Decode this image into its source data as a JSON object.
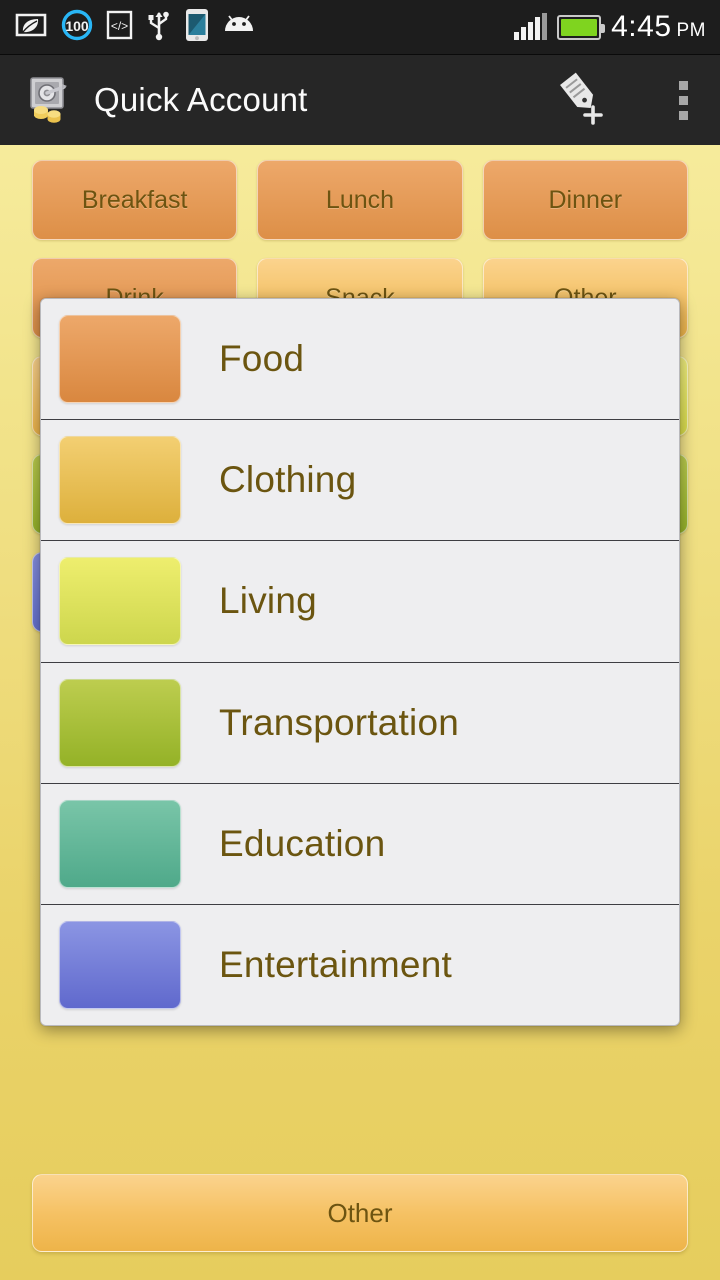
{
  "statusbar": {
    "icons": [
      "battery-saver-leaf-icon",
      "battery-100-circle-icon",
      "developer-mode-icon",
      "usb-icon",
      "phone-icon",
      "android-head-icon"
    ],
    "battery_level_label": "100",
    "signal_icon": "signal-bars-icon",
    "battery_icon": "battery-full-icon",
    "time": "4:45",
    "ampm": "PM"
  },
  "actionbar": {
    "app_icon": "safe-vault-coins-icon",
    "title": "Quick Account",
    "add_entry_icon": "add-note-pencil-icon",
    "overflow_icon": "overflow-menu-icon"
  },
  "grid": {
    "buttons": [
      {
        "label": "Breakfast",
        "color_top": "#eda86a",
        "color_bottom": "#dd8f47"
      },
      {
        "label": "Lunch",
        "color_top": "#eda86a",
        "color_bottom": "#dd8f47"
      },
      {
        "label": "Dinner",
        "color_top": "#eda86a",
        "color_bottom": "#dd8f47"
      },
      {
        "label": "Drink",
        "color_top": "#eda86a",
        "color_bottom": "#dd8f47"
      },
      {
        "label": "Snack",
        "color_top": "#fbd38d",
        "color_bottom": "#eeb449"
      },
      {
        "label": "Other",
        "color_top": "#fbd38d",
        "color_bottom": "#eeb449"
      },
      {
        "label": "",
        "color_top": "#fbd38d",
        "color_bottom": "#eeb449"
      },
      {
        "label": "",
        "color_top": "#f0ee7e",
        "color_bottom": "#d9dc4a"
      },
      {
        "label": "",
        "color_top": "#f0ee7e",
        "color_bottom": "#d9dc4a"
      },
      {
        "label": "",
        "color_top": "#bbcc4e",
        "color_bottom": "#96b32a"
      },
      {
        "label": "",
        "color_top": "#bbcc4e",
        "color_bottom": "#96b32a"
      },
      {
        "label": "",
        "color_top": "#bbcc4e",
        "color_bottom": "#96b32a"
      },
      {
        "label": "",
        "color_top": "#8690e0",
        "color_bottom": "#6571d0"
      }
    ]
  },
  "dialog": {
    "items": [
      {
        "label": "Food",
        "color_top": "#eda86a",
        "color_bottom": "#d9873f"
      },
      {
        "label": "Clothing",
        "color_top": "#f3cf72",
        "color_bottom": "#ddb03c"
      },
      {
        "label": "Living",
        "color_top": "#eeee6e",
        "color_bottom": "#cdd64d"
      },
      {
        "label": "Transportation",
        "color_top": "#bdcd4f",
        "color_bottom": "#94b227"
      },
      {
        "label": "Education",
        "color_top": "#79c5a8",
        "color_bottom": "#4fa98a"
      },
      {
        "label": "Entertainment",
        "color_top": "#8b95e3",
        "color_bottom": "#6069cd"
      }
    ]
  },
  "footer": {
    "other_label": "Other"
  },
  "theme": {
    "background_top": "#f9f2a6",
    "background_bottom": "#e6cd5d",
    "dialog_background": "#eeeef0",
    "label_color": "#6b5510",
    "actionbar_background": "#262626",
    "statusbar_background": "#1d1d1d"
  }
}
